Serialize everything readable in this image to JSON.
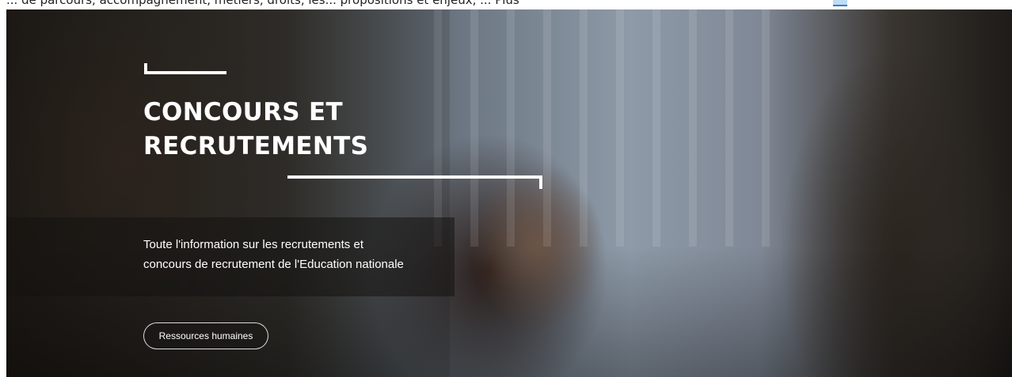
{
  "top_strip": {
    "text": "... de parcours, accompagnement, métiers, droits, les... propositions et enjeux, ... Plus"
  },
  "hero": {
    "title_lines": [
      "CONCOURS ET",
      "RECRUTEMENTS"
    ],
    "description_lines": [
      "Toute l'information sur les recrutements et",
      "concours de recrutement de l'Education nationale"
    ],
    "tag_button": "Ressources humaines"
  }
}
